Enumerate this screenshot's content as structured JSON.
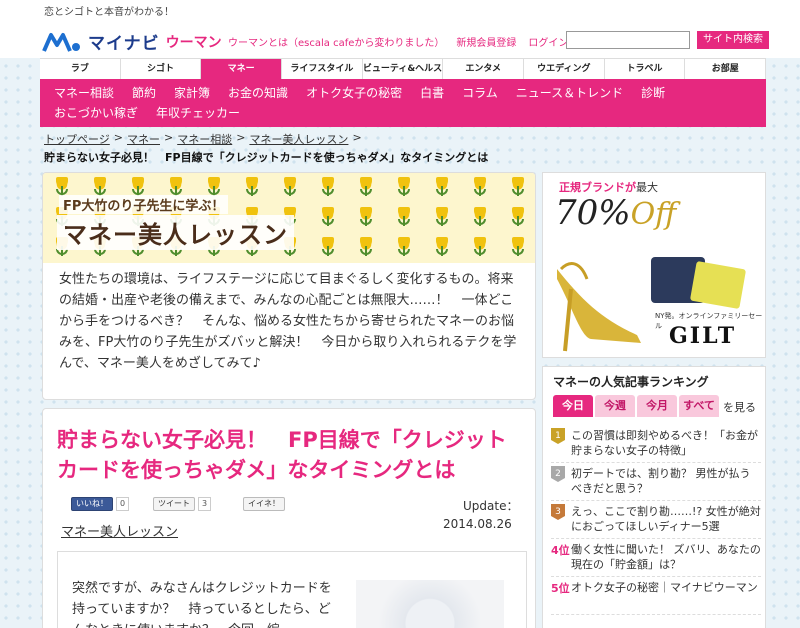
{
  "tagline": "恋とシゴトと本音がわかる！",
  "header": {
    "logo_text": "マイナビ",
    "logo_sub": "ウーマン",
    "links": [
      "ウーマンとは（escala cafeから変わりました）",
      "新規会員登録",
      "ログイン"
    ],
    "search_placeholder": "",
    "search_button": "サイト内検索"
  },
  "nav": {
    "items": [
      "ラブ",
      "シゴト",
      "マネー",
      "ライフスタイル",
      "ビューティ&ヘルス",
      "エンタメ",
      "ウエディング",
      "トラベル",
      "お部屋"
    ],
    "active": "マネー"
  },
  "subnav": {
    "row1": [
      "マネー相談",
      "節約",
      "家計簿",
      "お金の知識",
      "オトク女子の秘密",
      "白書",
      "コラム",
      "ニュース＆トレンド",
      "診断"
    ],
    "row2": [
      "おこづかい稼ぎ",
      "年収チェッカー"
    ]
  },
  "breadcrumb": [
    "トップページ",
    "マネー",
    "マネー相談",
    "マネー美人レッスン"
  ],
  "page_title": "貯まらない女子必見！　FP目線で「クレジットカードを使っちゃダメ」なタイミングとは",
  "banner": {
    "sub": "FP大竹のり子先生に学ぶ！",
    "title": "マネー美人レッスン",
    "text": "女性たちの環境は、ライフステージに応じて目まぐるしく変化するもの。将来の結婚・出産や老後の備えまで、みんなの心配ごとは無限大……！　一体どこから手をつけるべき？　そんな、悩める女性たちから寄せられたマネーのお悩みを、FP大竹のり子先生がズバッと解決！　今日から取り入れられるテクを学んで、マネー美人をめざしてみて♪"
  },
  "article": {
    "title": "貯まらない女子必見！　FP目線で「クレジットカードを使っちゃダメ」なタイミングとは",
    "share": {
      "fb_label": "いいね！",
      "fb_count": "0",
      "tw_label": "ツイート",
      "tw_count": "3",
      "mixi_label": "イイネ！"
    },
    "category": "マネー美人レッスン",
    "update_label": "Update：",
    "update_date": "2014.08.26",
    "body": "突然ですが、みなさんはクレジットカードを持っていますか？　持っているとしたら、どんなときに使いますか？　今回、編"
  },
  "ad": {
    "top_prefix": "正規ブランドが",
    "top_suffix": "最大",
    "big": "70%",
    "off": "Off",
    "small": "NY発。オンラインファミリーセール",
    "brand": "GILT"
  },
  "ranking": {
    "title": "マネーの人気記事ランキング",
    "tabs": [
      "今日",
      "今週",
      "今月",
      "すべて"
    ],
    "active_tab": "今日",
    "more": "を見る",
    "items": [
      {
        "rank": "1",
        "text": "この習慣は即刻やめるべき！「お金が貯まらない女子の特徴」",
        "color": "#c9a227"
      },
      {
        "rank": "2",
        "text": "初デートでは、割り勘？ 男性が払うべきだと思う？",
        "color": "#a8a8a8"
      },
      {
        "rank": "3",
        "text": "えっ、ここで割り勘……!? 女性が絶対におごってほしいディナー5選",
        "color": "#c57a3a"
      },
      {
        "rank": "4位",
        "text": "働く女性に聞いた！ ズバリ、あなたの現在の「貯金額」は？",
        "color": ""
      },
      {
        "rank": "5位",
        "text": "オトク女子の秘密｜マイナビウーマン",
        "color": ""
      }
    ]
  }
}
